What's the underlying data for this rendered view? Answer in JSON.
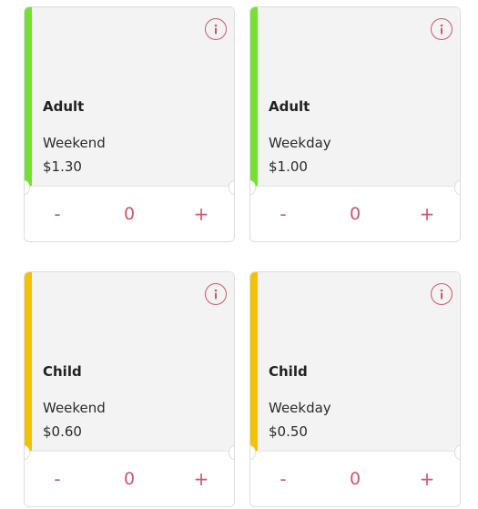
{
  "colors": {
    "adult_stripe": "#76df32",
    "child_stripe": "#f2c200",
    "accent": "#d0546f"
  },
  "cards": [
    {
      "title": "Adult",
      "period": "Weekend",
      "price": "$1.30",
      "minus": "-",
      "qty": "0",
      "plus": "+",
      "icon": "info-icon"
    },
    {
      "title": "Adult",
      "period": "Weekday",
      "price": "$1.00",
      "minus": "-",
      "qty": "0",
      "plus": "+",
      "icon": "info-icon"
    },
    {
      "title": "Child",
      "period": "Weekend",
      "price": "$0.60",
      "minus": "-",
      "qty": "0",
      "plus": "+",
      "icon": "info-icon"
    },
    {
      "title": "Child",
      "period": "Weekday",
      "price": "$0.50",
      "minus": "-",
      "qty": "0",
      "plus": "+",
      "icon": "info-icon"
    }
  ]
}
